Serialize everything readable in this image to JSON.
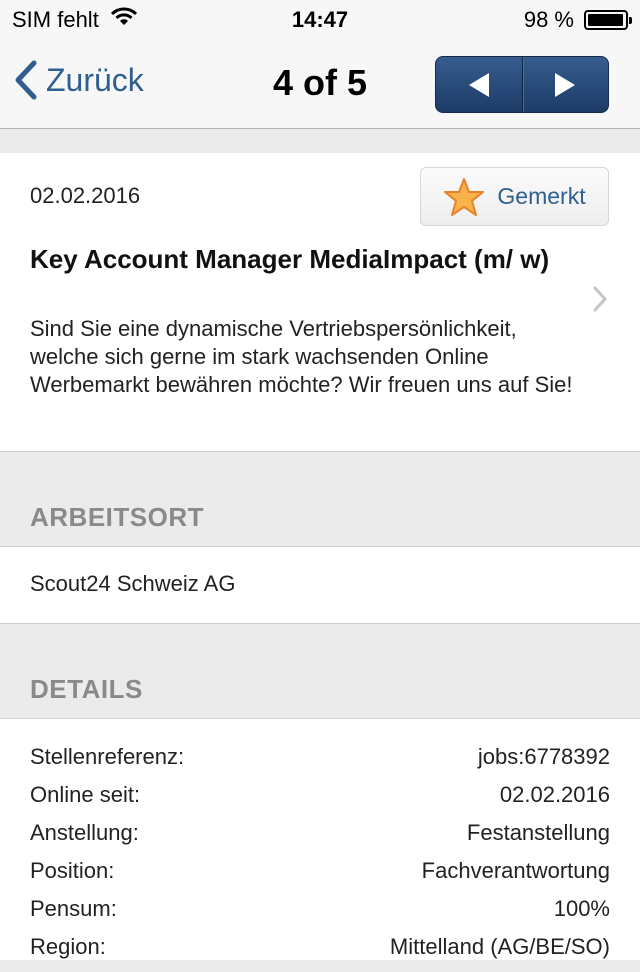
{
  "status_bar": {
    "carrier": "SIM fehlt",
    "time": "14:47",
    "battery": "98 %",
    "battery_level": 0.98,
    "icons": [
      "wifi-icon",
      "battery-icon"
    ]
  },
  "nav": {
    "back_label": "Zurück",
    "title": "4 of 5",
    "prev_icon": "triangle-left-icon",
    "next_icon": "triangle-right-icon",
    "accent": "#2f5f91"
  },
  "job": {
    "date": "02.02.2016",
    "favorite_label": "Gemerkt",
    "favorite_icon": "star-icon",
    "title": "Key Account Manager MediaImpact (m/ w)",
    "description": "Sind Sie eine dynamische Vertriebspersönlichkeit, welche sich gerne im stark wachsenden Online Werbemarkt bewähren möchte? Wir freuen uns auf Sie!"
  },
  "arbeitsort": {
    "heading": "ARBEITSORT",
    "value": "Scout24 Schweiz AG"
  },
  "details": {
    "heading": "DETAILS",
    "rows": [
      {
        "label": "Stellenreferenz:",
        "value": "jobs:6778392"
      },
      {
        "label": "Online seit:",
        "value": "02.02.2016"
      },
      {
        "label": "Anstellung:",
        "value": "Festanstellung"
      },
      {
        "label": "Position:",
        "value": "Fachverantwortung"
      },
      {
        "label": "Pensum:",
        "value": "100%"
      },
      {
        "label": "Region:",
        "value": "Mittelland (AG/BE/SO)"
      }
    ]
  }
}
